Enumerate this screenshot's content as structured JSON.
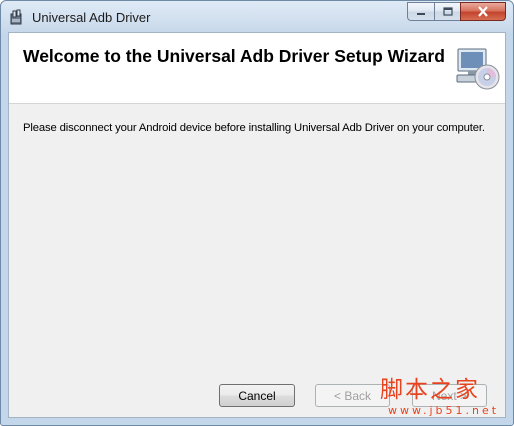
{
  "window": {
    "title": "Universal Adb Driver",
    "controls": {
      "minimize": "minimize",
      "maximize": "maximize",
      "close": "close"
    }
  },
  "banner": {
    "title": "Welcome to the Universal Adb Driver Setup Wizard",
    "icon": "computer-cd-icon"
  },
  "body": {
    "message": "Please disconnect your Android device before installing Universal Adb Driver on your computer."
  },
  "buttons": {
    "cancel": "Cancel",
    "back": "< Back",
    "next": "Next >"
  },
  "watermark": {
    "chinese": "脚本之家",
    "url": "www.jb51.net"
  },
  "colors": {
    "close_button": "#c4442d",
    "watermark": "#e8431f"
  }
}
